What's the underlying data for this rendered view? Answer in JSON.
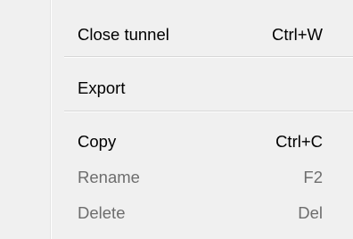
{
  "context_menu": {
    "items": [
      {
        "label": "Close tunnel",
        "shortcut": "Ctrl+W",
        "disabled": false
      },
      {
        "label": "Export",
        "shortcut": "",
        "disabled": false
      },
      {
        "label": "Copy",
        "shortcut": "Ctrl+C",
        "disabled": false
      },
      {
        "label": "Rename",
        "shortcut": "F2",
        "disabled": true
      },
      {
        "label": "Delete",
        "shortcut": "Del",
        "disabled": true
      }
    ]
  },
  "colors": {
    "menu_background": "#f0f0f0",
    "text_enabled": "#000000",
    "text_disabled": "#6d6d6d",
    "separator": "#d7d7d7"
  }
}
